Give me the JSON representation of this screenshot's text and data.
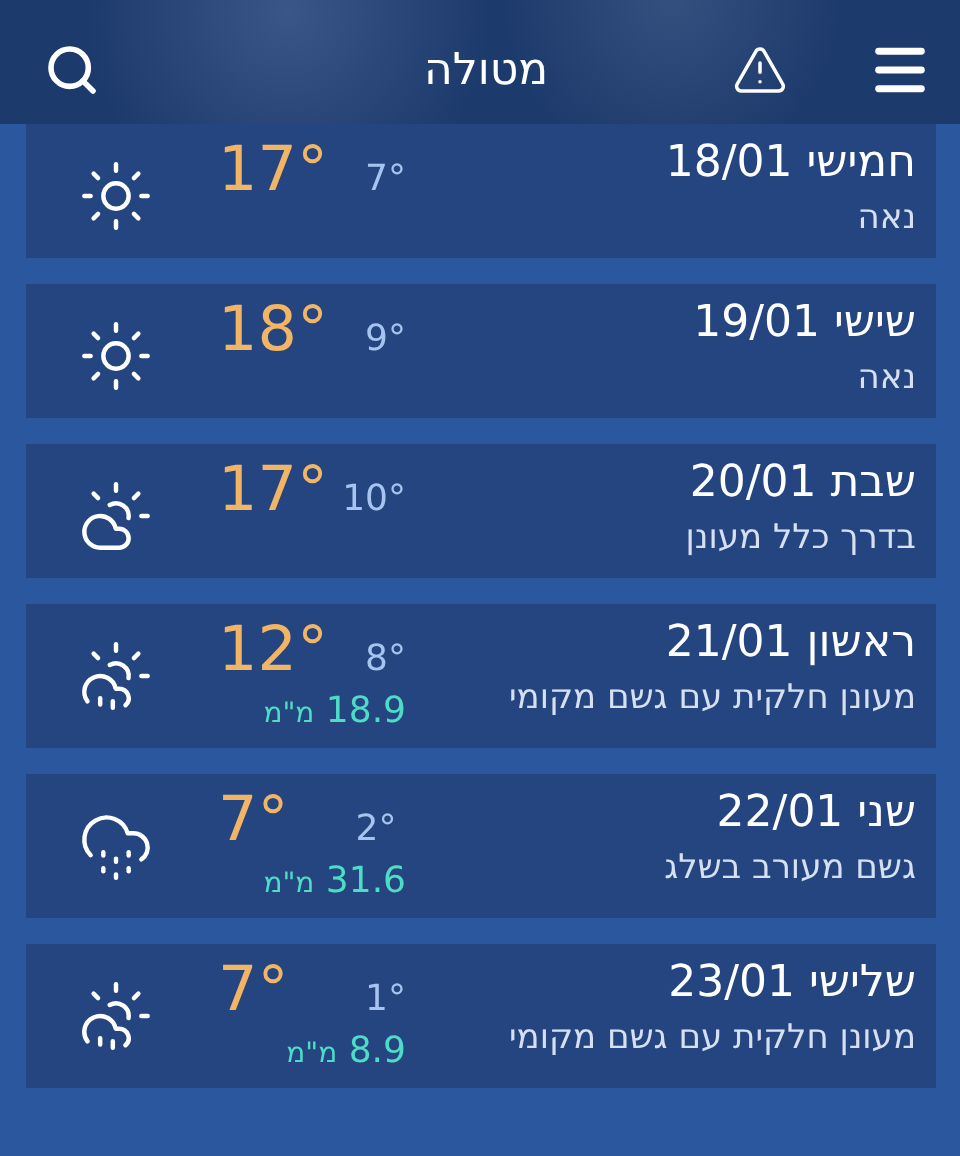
{
  "header": {
    "title": "מטולה"
  },
  "days": [
    {
      "heading": "חמישי 18/01",
      "description": "נאה",
      "high": "17°",
      "low": "7°",
      "kind": "sun"
    },
    {
      "heading": "שישי 19/01",
      "description": "נאה",
      "high": "18°",
      "low": "9°",
      "kind": "sun"
    },
    {
      "heading": "שבת 20/01",
      "description": "בדרך כלל מעונן",
      "high": "17°",
      "low": "10°",
      "kind": "partly_cloudy"
    },
    {
      "heading": "ראשון 21/01",
      "description": "מעונן חלקית עם גשם מקומי",
      "high": "12°",
      "low": "8°",
      "precipitation": "18.9",
      "unit": "מ\"מ",
      "kind": "showers"
    },
    {
      "heading": "שני 22/01",
      "description": "גשם מעורב בשלג",
      "high": "7°",
      "low": "2°",
      "precipitation": "31.6",
      "unit": "מ\"מ",
      "kind": "sleet"
    },
    {
      "heading": "שלישי 23/01",
      "description": "מעונן חלקית עם גשם מקומי",
      "high": "7°",
      "low": "1°",
      "precipitation": "8.9",
      "unit": "מ\"מ",
      "kind": "showers"
    }
  ]
}
